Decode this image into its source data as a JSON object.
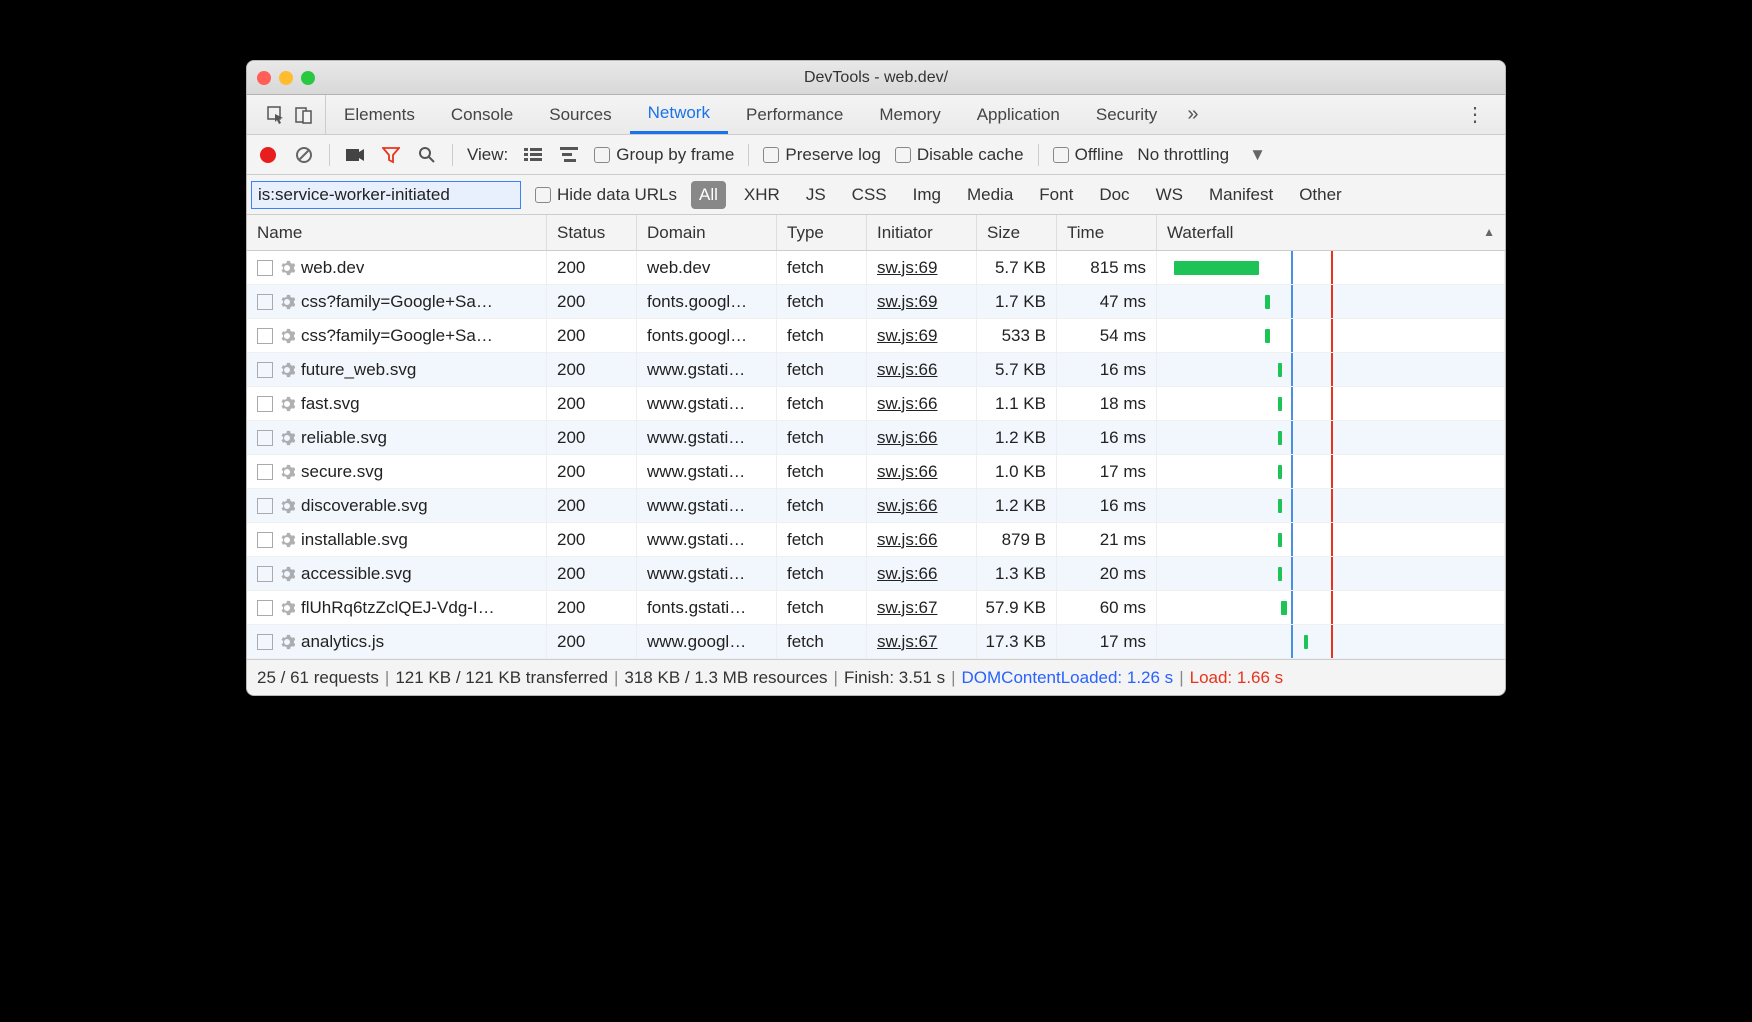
{
  "window": {
    "title": "DevTools - web.dev/"
  },
  "tabs": [
    "Elements",
    "Console",
    "Sources",
    "Network",
    "Performance",
    "Memory",
    "Application",
    "Security"
  ],
  "activeTab": "Network",
  "toolbar": {
    "viewLabel": "View:",
    "groupByFrame": "Group by frame",
    "preserveLog": "Preserve log",
    "disableCache": "Disable cache",
    "offline": "Offline",
    "throttling": "No throttling"
  },
  "filter": {
    "value": "is:service-worker-initiated",
    "hideDataURLs": "Hide data URLs",
    "types": [
      "All",
      "XHR",
      "JS",
      "CSS",
      "Img",
      "Media",
      "Font",
      "Doc",
      "WS",
      "Manifest",
      "Other"
    ],
    "activeType": "All"
  },
  "columns": [
    "Name",
    "Status",
    "Domain",
    "Type",
    "Initiator",
    "Size",
    "Time",
    "Waterfall"
  ],
  "requests": [
    {
      "name": "web.dev",
      "status": "200",
      "domain": "web.dev",
      "type": "fetch",
      "initiator": "sw.js:69",
      "size": "5.7 KB",
      "time": "815 ms",
      "wfStart": 2,
      "wfWidth": 26
    },
    {
      "name": "css?family=Google+Sa…",
      "status": "200",
      "domain": "fonts.googl…",
      "type": "fetch",
      "initiator": "sw.js:69",
      "size": "1.7 KB",
      "time": "47 ms",
      "wfStart": 30,
      "wfWidth": 1.4
    },
    {
      "name": "css?family=Google+Sa…",
      "status": "200",
      "domain": "fonts.googl…",
      "type": "fetch",
      "initiator": "sw.js:69",
      "size": "533 B",
      "time": "54 ms",
      "wfStart": 30,
      "wfWidth": 1.4
    },
    {
      "name": "future_web.svg",
      "status": "200",
      "domain": "www.gstati…",
      "type": "fetch",
      "initiator": "sw.js:66",
      "size": "5.7 KB",
      "time": "16 ms",
      "wfStart": 34,
      "wfWidth": 1.2
    },
    {
      "name": "fast.svg",
      "status": "200",
      "domain": "www.gstati…",
      "type": "fetch",
      "initiator": "sw.js:66",
      "size": "1.1 KB",
      "time": "18 ms",
      "wfStart": 34,
      "wfWidth": 1.2
    },
    {
      "name": "reliable.svg",
      "status": "200",
      "domain": "www.gstati…",
      "type": "fetch",
      "initiator": "sw.js:66",
      "size": "1.2 KB",
      "time": "16 ms",
      "wfStart": 34,
      "wfWidth": 1.2
    },
    {
      "name": "secure.svg",
      "status": "200",
      "domain": "www.gstati…",
      "type": "fetch",
      "initiator": "sw.js:66",
      "size": "1.0 KB",
      "time": "17 ms",
      "wfStart": 34,
      "wfWidth": 1.2
    },
    {
      "name": "discoverable.svg",
      "status": "200",
      "domain": "www.gstati…",
      "type": "fetch",
      "initiator": "sw.js:66",
      "size": "1.2 KB",
      "time": "16 ms",
      "wfStart": 34,
      "wfWidth": 1.2
    },
    {
      "name": "installable.svg",
      "status": "200",
      "domain": "www.gstati…",
      "type": "fetch",
      "initiator": "sw.js:66",
      "size": "879 B",
      "time": "21 ms",
      "wfStart": 34,
      "wfWidth": 1.2
    },
    {
      "name": "accessible.svg",
      "status": "200",
      "domain": "www.gstati…",
      "type": "fetch",
      "initiator": "sw.js:66",
      "size": "1.3 KB",
      "time": "20 ms",
      "wfStart": 34,
      "wfWidth": 1.2
    },
    {
      "name": "flUhRq6tzZclQEJ-Vdg-I…",
      "status": "200",
      "domain": "fonts.gstati…",
      "type": "fetch",
      "initiator": "sw.js:67",
      "size": "57.9 KB",
      "time": "60 ms",
      "wfStart": 35,
      "wfWidth": 1.6
    },
    {
      "name": "analytics.js",
      "status": "200",
      "domain": "www.googl…",
      "type": "fetch",
      "initiator": "sw.js:67",
      "size": "17.3 KB",
      "time": "17 ms",
      "wfStart": 42,
      "wfWidth": 1.2
    }
  ],
  "waterfall": {
    "blueLine": 38,
    "redLine": 50
  },
  "status": {
    "requests": "25 / 61 requests",
    "transferred": "121 KB / 121 KB transferred",
    "resources": "318 KB / 1.3 MB resources",
    "finish": "Finish: 3.51 s",
    "dcl": "DOMContentLoaded: 1.26 s",
    "load": "Load: 1.66 s"
  }
}
